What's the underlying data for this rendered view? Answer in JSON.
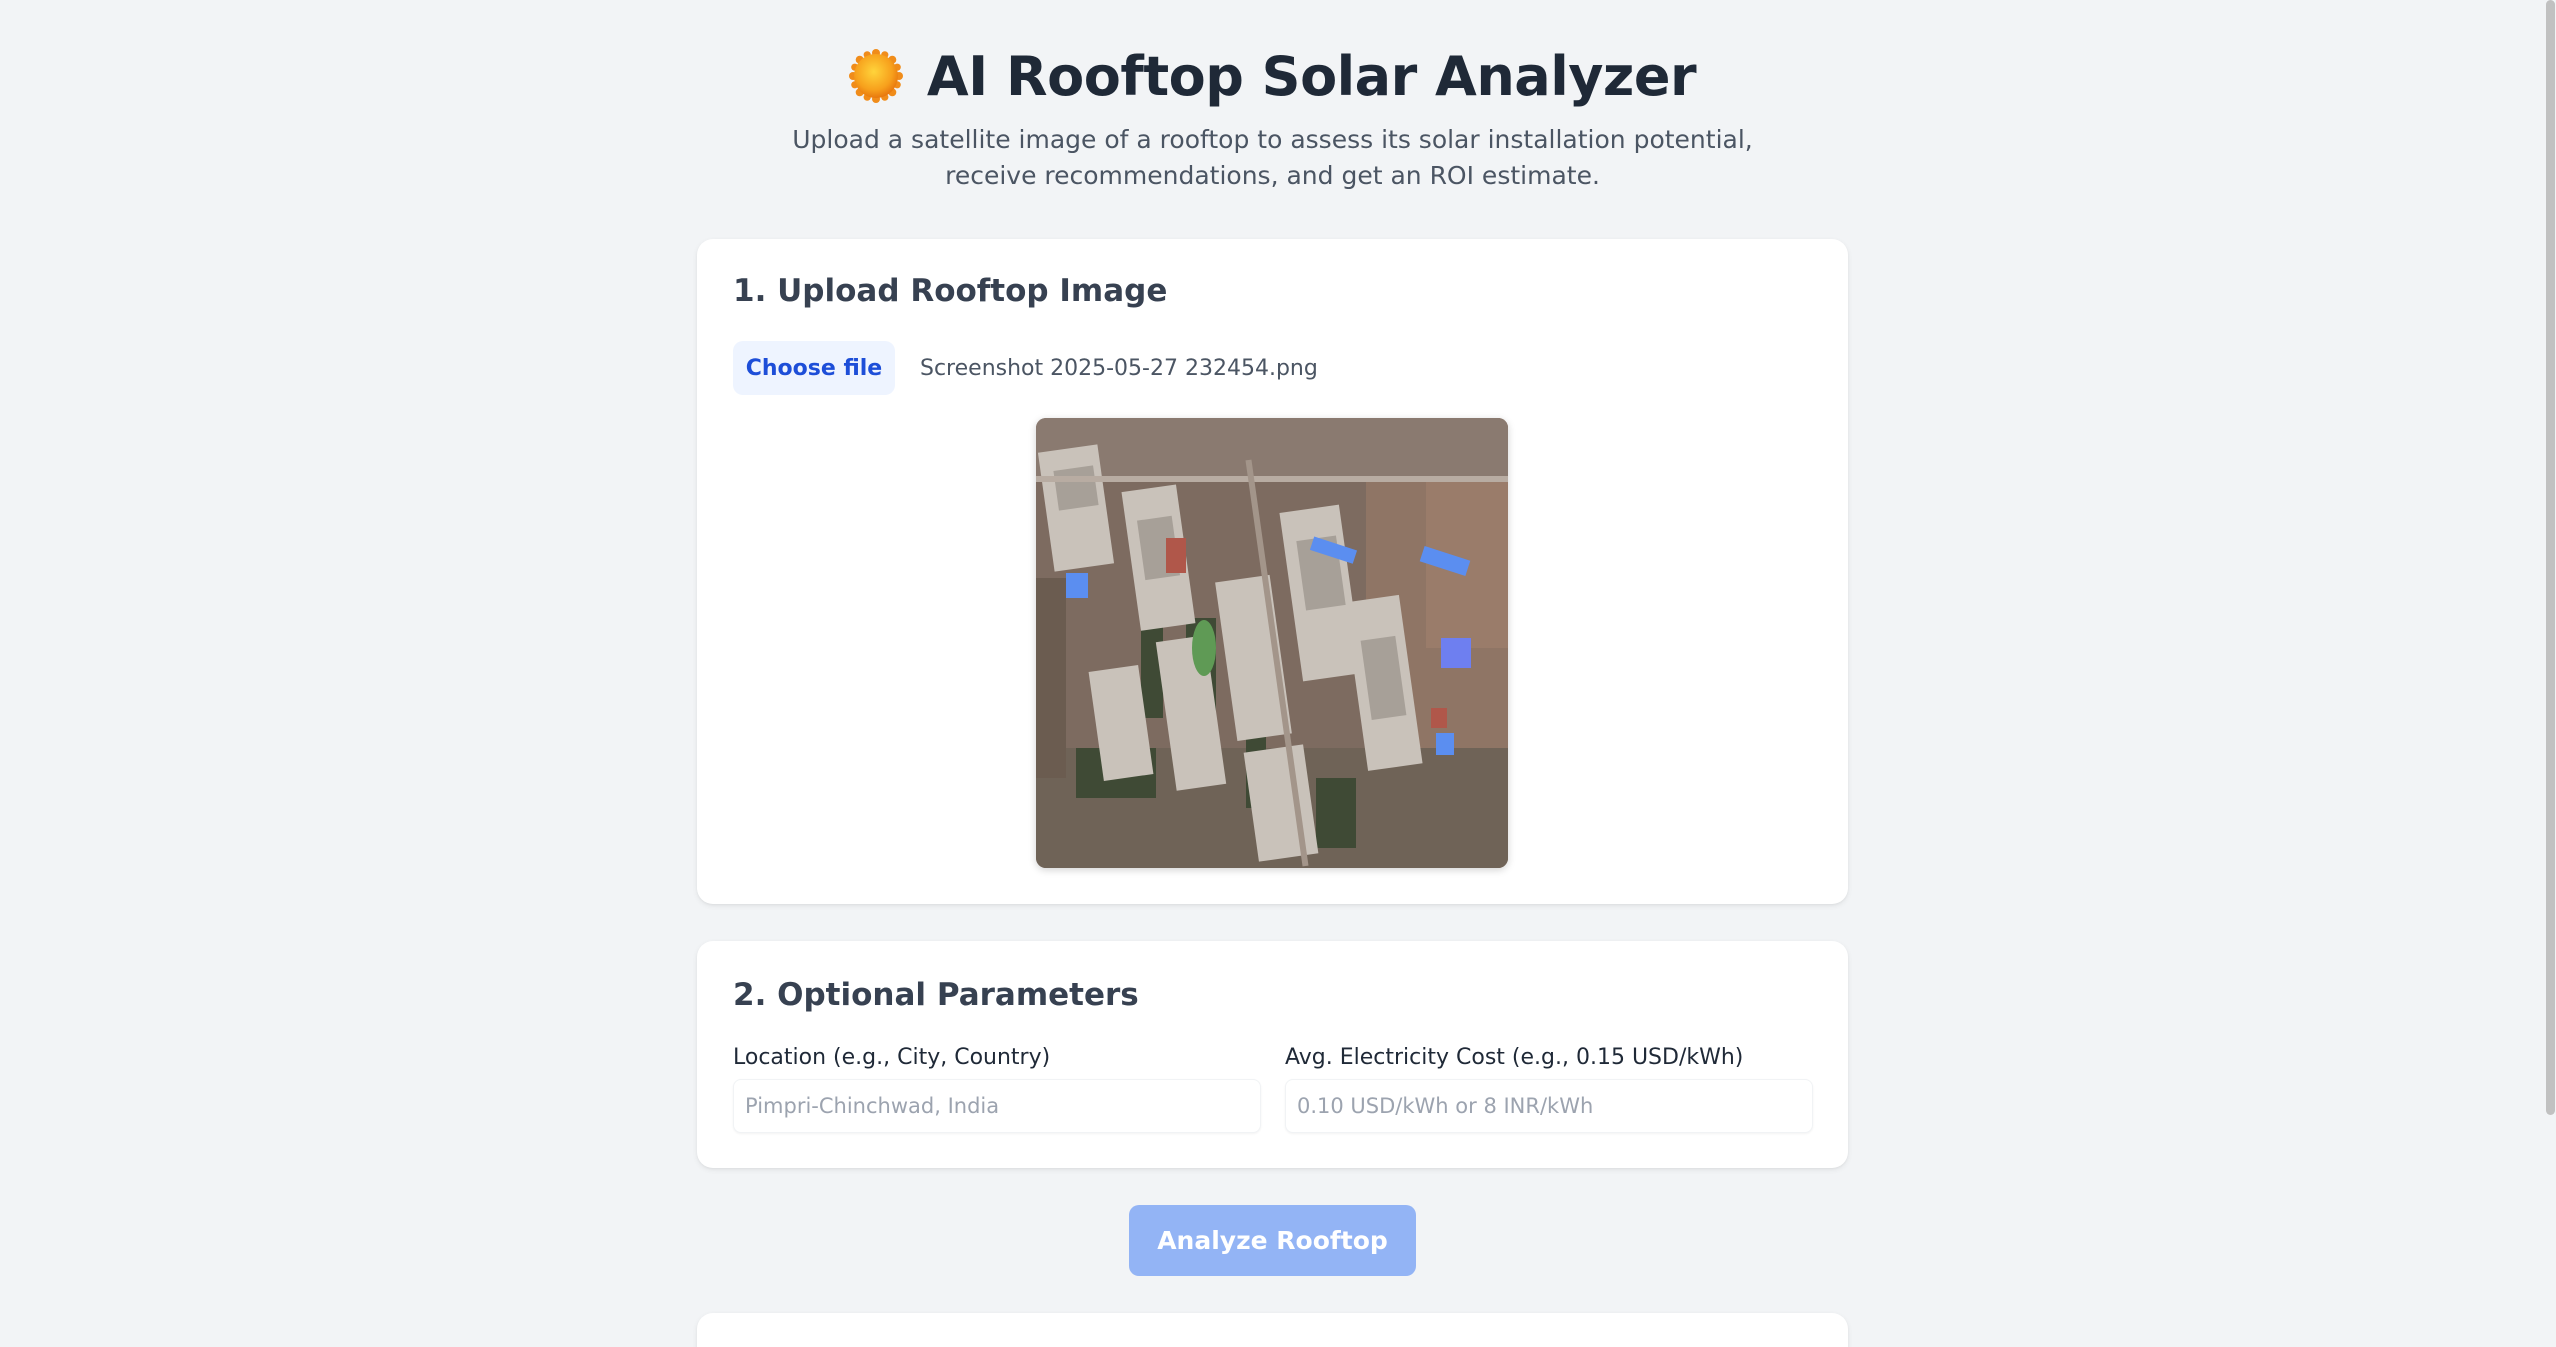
{
  "header": {
    "icon": "sun-icon",
    "title": "AI Rooftop Solar Analyzer",
    "subtitle": "Upload a satellite image of a rooftop to assess its solar installation potential, receive recommendations, and get an ROI estimate."
  },
  "upload": {
    "title": "1. Upload Rooftop Image",
    "choose_label": "Choose file",
    "file_name": "Screenshot 2025-05-27 232454.png"
  },
  "params": {
    "title": "2. Optional Parameters",
    "location": {
      "label": "Location (e.g., City, Country)",
      "placeholder": "Pimpri-Chinchwad, India",
      "value": ""
    },
    "cost": {
      "label": "Avg. Electricity Cost (e.g., 0.15 USD/kWh)",
      "placeholder": "0.10 USD/kWh or 8 INR/kWh",
      "value": ""
    }
  },
  "actions": {
    "analyze_label": "Analyze Rooftop"
  },
  "colors": {
    "background": "#f2f4f6",
    "accent": "#1d4ed8",
    "button_disabled": "#93b4f5",
    "choose_bg": "#eef4ff"
  }
}
